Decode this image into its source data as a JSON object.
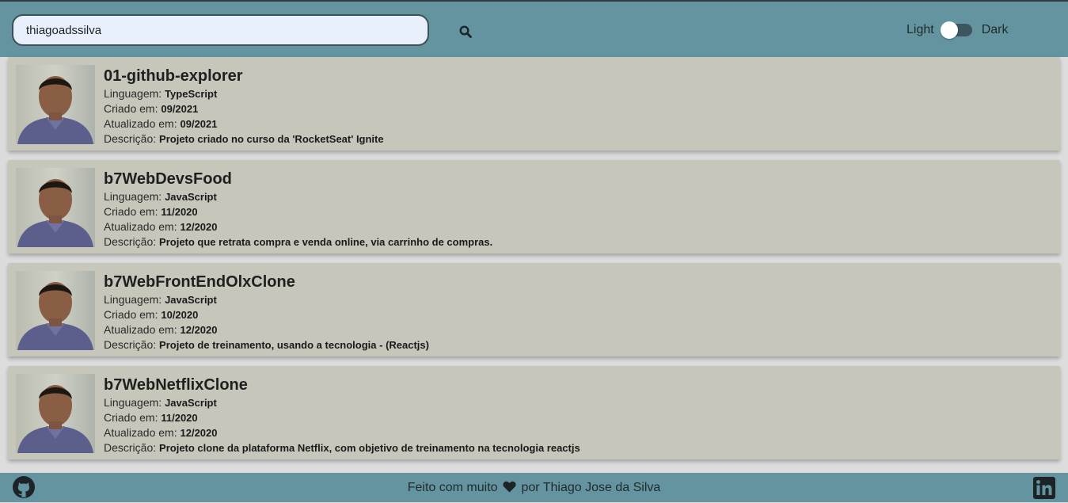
{
  "header": {
    "search": {
      "value": "thiagoadssilva"
    },
    "theme": {
      "light_label": "Light",
      "dark_label": "Dark",
      "icon": "search-icon"
    }
  },
  "repos": [
    {
      "name": "01-github-explorer",
      "language_label": "Linguagem:",
      "language": "TypeScript",
      "created_label": "Criado em:",
      "created": "09/2021",
      "updated_label": "Atualizado em:",
      "updated": "09/2021",
      "description_label": "Descrição:",
      "description": "Projeto criado no curso da 'RocketSeat' Ignite"
    },
    {
      "name": "b7WebDevsFood",
      "language_label": "Linguagem:",
      "language": "JavaScript",
      "created_label": "Criado em:",
      "created": "11/2020",
      "updated_label": "Atualizado em:",
      "updated": "12/2020",
      "description_label": "Descrição:",
      "description": "Projeto que retrata compra e venda online, via carrinho de compras."
    },
    {
      "name": "b7WebFrontEndOlxClone",
      "language_label": "Linguagem:",
      "language": "JavaScript",
      "created_label": "Criado em:",
      "created": "10/2020",
      "updated_label": "Atualizado em:",
      "updated": "12/2020",
      "description_label": "Descrição:",
      "description": "Projeto de treinamento, usando a tecnologia - (Reactjs)"
    },
    {
      "name": "b7WebNetflixClone",
      "language_label": "Linguagem:",
      "language": "JavaScript",
      "created_label": "Criado em:",
      "created": "11/2020",
      "updated_label": "Atualizado em:",
      "updated": "12/2020",
      "description_label": "Descrição:",
      "description": "Projeto clone da plataforma Netflix, com objetivo de treinamento na tecnologia reactjs"
    }
  ],
  "footer": {
    "credit_prefix": "Feito com muito",
    "credit_suffix": "por Thiago Jose da Silva"
  },
  "colors": {
    "header_bg": "#6494a0",
    "card_bg": "#c6c6bb",
    "page_bg": "#dcdcdc",
    "input_bg": "#e8f0fe"
  }
}
